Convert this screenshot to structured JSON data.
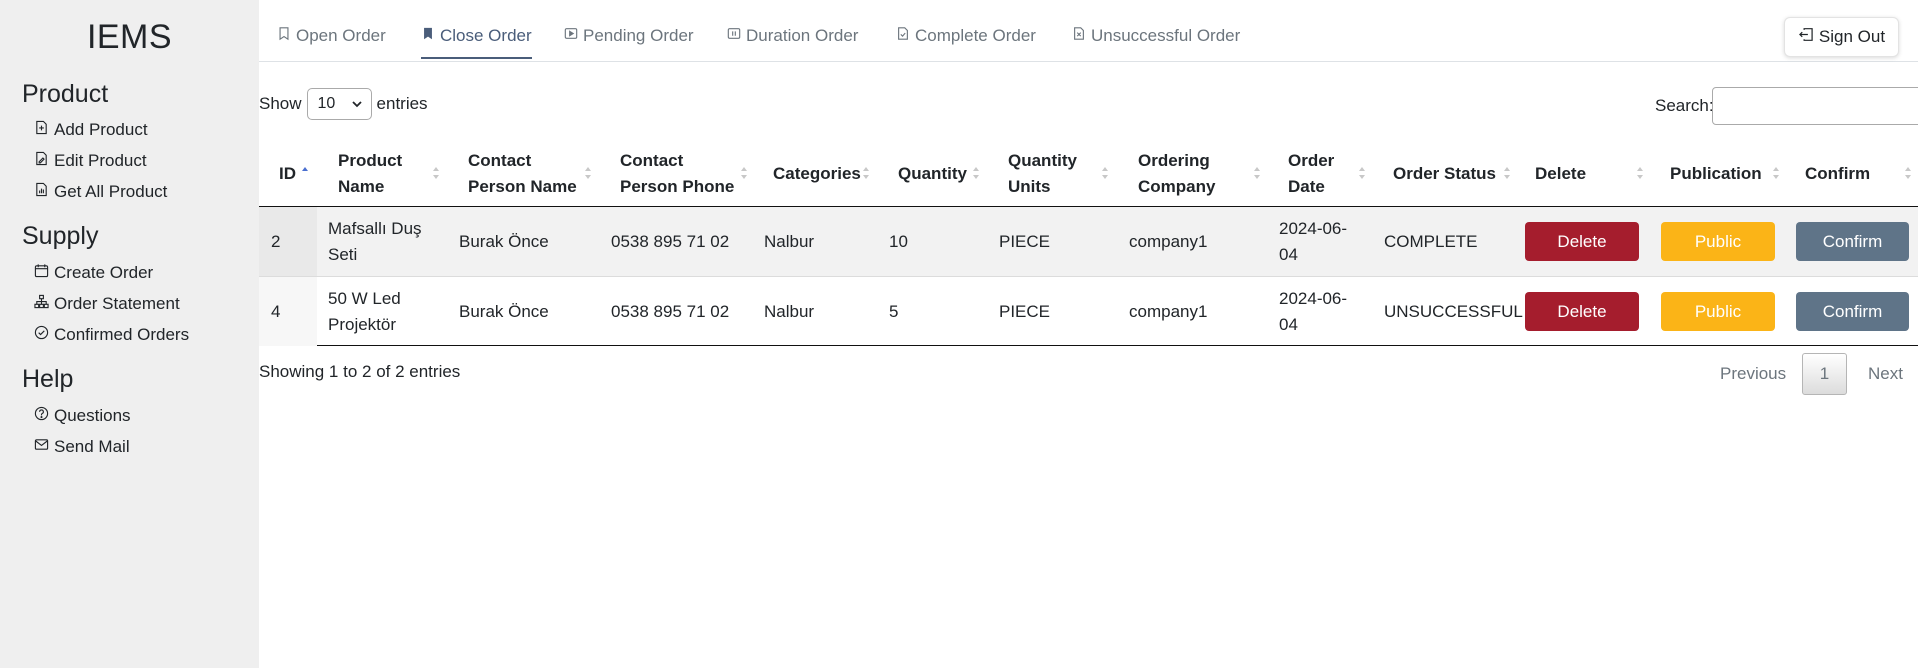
{
  "sidebar": {
    "brand": "IEMS",
    "sections": [
      {
        "title": "Product",
        "items": [
          {
            "label": "Add Product",
            "icon": "file-plus-icon"
          },
          {
            "label": "Edit Product",
            "icon": "file-edit-icon"
          },
          {
            "label": "Get All Product",
            "icon": "file-chart-icon"
          }
        ]
      },
      {
        "title": "Supply",
        "items": [
          {
            "label": "Create Order",
            "icon": "calendar-icon"
          },
          {
            "label": "Order Statement",
            "icon": "diagram-icon"
          },
          {
            "label": "Confirmed Orders",
            "icon": "check-circle-icon"
          }
        ]
      },
      {
        "title": "Help",
        "items": [
          {
            "label": "Questions",
            "icon": "question-circle-icon"
          },
          {
            "label": "Send Mail",
            "icon": "envelope-icon"
          }
        ]
      }
    ]
  },
  "tabs": [
    {
      "label": "Open Order",
      "icon": "bookmark-icon",
      "active": false
    },
    {
      "label": "Close Order",
      "icon": "bookmark-fill-icon",
      "active": true
    },
    {
      "label": "Pending Order",
      "icon": "play-icon",
      "active": false
    },
    {
      "label": "Duration Order",
      "icon": "pause-icon",
      "active": false
    },
    {
      "label": "Complete Order",
      "icon": "file-check-icon",
      "active": false
    },
    {
      "label": "Unsuccessful Order",
      "icon": "file-x-icon",
      "active": false
    }
  ],
  "signout": {
    "label": "Sign Out",
    "icon": "box-arrow-left-icon"
  },
  "table_controls": {
    "show_label": "Show",
    "entries_value": "10",
    "entries_label": "entries",
    "search_label": "Search:",
    "search_value": ""
  },
  "table": {
    "headers": [
      {
        "label": "ID",
        "sorted": "asc"
      },
      {
        "label": "Product\nName"
      },
      {
        "label": "Contact\nPerson Name"
      },
      {
        "label": "Contact\nPerson Phone"
      },
      {
        "label": "Categories"
      },
      {
        "label": "Quantity"
      },
      {
        "label": "Quantity\nUnits"
      },
      {
        "label": "Ordering\nCompany"
      },
      {
        "label": "Order\nDate"
      },
      {
        "label": "Order Status"
      },
      {
        "label": "Delete"
      },
      {
        "label": "Publication"
      },
      {
        "label": "Confirm"
      }
    ],
    "rows": [
      {
        "id": "2",
        "product_name": "Mafsallı Duş\nSeti",
        "contact_name": "Burak Önce",
        "contact_phone": "0538 895 71 02",
        "category": "Nalbur",
        "quantity": "10",
        "units": "PIECE",
        "company": "company1",
        "date": "2024-06-\n04",
        "status": "COMPLETE",
        "delete_label": "Delete",
        "public_label": "Public",
        "confirm_label": "Confirm"
      },
      {
        "id": "4",
        "product_name": "50 W Led\nProjektör",
        "contact_name": "Burak Önce",
        "contact_phone": "0538 895 71 02",
        "category": "Nalbur",
        "quantity": "5",
        "units": "PIECE",
        "company": "company1",
        "date": "2024-06-\n04",
        "status": "UNSUCCESSFUL",
        "delete_label": "Delete",
        "public_label": "Public",
        "confirm_label": "Confirm"
      }
    ]
  },
  "footer": {
    "info": "Showing 1 to 2 of 2 entries",
    "previous": "Previous",
    "current_page": "1",
    "next": "Next"
  },
  "colors": {
    "sidebar_bg": "#efefef",
    "active_tab": "#4a5d7a",
    "delete_button": "#a51d2d",
    "public_button": "#fbb417",
    "confirm_button": "#5f7488"
  }
}
